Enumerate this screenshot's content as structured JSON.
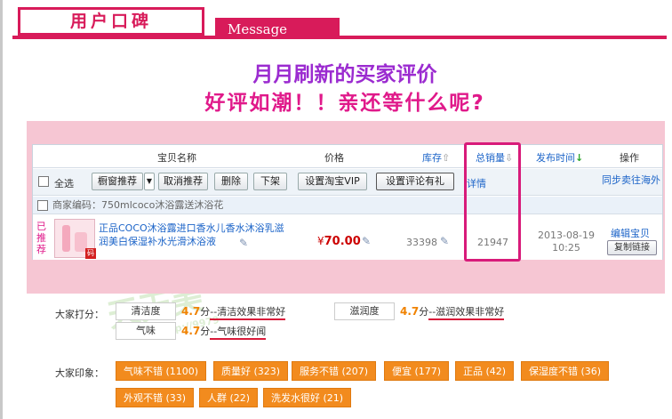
{
  "header": {
    "tab_title": "用户口碑",
    "message_label": "Message"
  },
  "slogans": {
    "line1": "月月刷新的买家评价",
    "line2": "好评如潮！！亲还等什么呢?"
  },
  "table": {
    "columns": {
      "name": "宝贝名称",
      "price": "价格",
      "stock": "库存",
      "total_sales": "总销量",
      "publish_time": "发布时间",
      "operation": "操作"
    },
    "toolbar": {
      "select_all": "全选",
      "window_recommend": "橱窗推荐",
      "cancel_recommend": "取消推荐",
      "delete": "删除",
      "offline": "下架",
      "set_vip": "设置淘宝VIP",
      "set_gift": "设置评论有礼",
      "detail": "详情",
      "sync_sell": "同步卖往海外"
    },
    "merchant_line": "商家编码：750mlcoco沐浴露送沐浴花",
    "row": {
      "badge": "已推荐",
      "thumb_stamp": "码",
      "title": "正品COCO沐浴露进口香水儿香水沐浴乳滋润美白保湿补水光滑沐浴液",
      "price_symbol": "¥",
      "price": "70.00",
      "stock": "33398",
      "total_sales": "21947",
      "date": "2013-08-19",
      "time": "10:25",
      "edit_link": "编辑宝贝",
      "copy_button": "复制链接"
    }
  },
  "ratings": {
    "label": "大家打分：",
    "items": [
      {
        "name": "清洁度",
        "score": "4.7",
        "unit": "分",
        "comment": "--清洁效果非常好"
      },
      {
        "name": "滋润度",
        "score": "4.7",
        "unit": "分",
        "comment": "--滋润效果非常好"
      },
      {
        "name": "气味",
        "score": "4.7",
        "unit": "分",
        "comment": "--气味很好闻"
      }
    ]
  },
  "impressions": {
    "label": "大家印象：",
    "tags": [
      "气味不错 (1100)",
      "质量好 (323)",
      "服务不错 (207)",
      "便宜 (177)",
      "正品 (42)",
      "保湿度不错 (36)",
      "外观不错 (33)",
      "人群 (22)",
      "洗发水很好 (21)"
    ]
  },
  "watermark": {
    "text": "天天美",
    "url": "http://9979"
  },
  "colors": {
    "brand": "#d81b5a",
    "pink_band": "#f6c6d3",
    "tag_orange": "#f28b1e",
    "link_blue": "#1c64c8",
    "highlight": "#d81b7a"
  },
  "icons": {
    "sort_arrow": "arrow-down-icon",
    "edit": "pencil-icon"
  }
}
